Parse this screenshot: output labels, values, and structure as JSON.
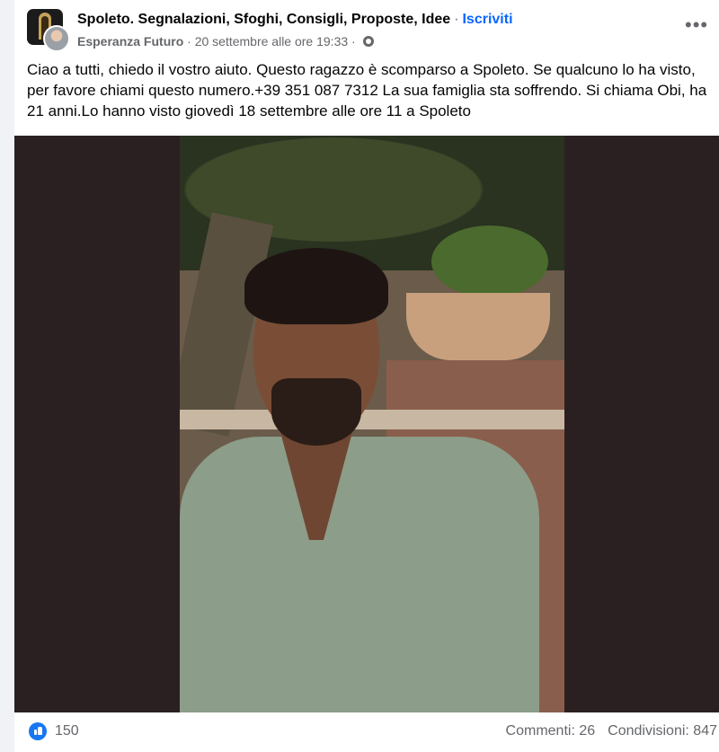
{
  "post": {
    "group_name": "Spoleto. Segnalazioni, Sfoghi, Consigli, Proposte, Idee",
    "separator": "·",
    "join_label": "Iscriviti",
    "author": "Esperanza Futuro",
    "meta_separator": "·",
    "timestamp": "20 settembre alle ore 19:33",
    "more_label": "•••",
    "text": "Ciao a tutti, chiedo il vostro aiuto. Questo ragazzo è scomparso a Spoleto. Se qualcuno lo ha visto, per favore chiami questo numero.+39 351 087 7312  La sua famiglia sta soffrendo. Si chiama Obi, ha 21 anni.Lo hanno visto giovedì 18 settembre alle ore 11 a Spoleto"
  },
  "footer": {
    "like_count": "150",
    "comments": "Commenti: 26",
    "shares": "Condivisioni: 847"
  },
  "colors": {
    "link": "#0866ff",
    "like": "#1877f2",
    "secondary_text": "#65676b",
    "photo_background": "#2b2021"
  }
}
